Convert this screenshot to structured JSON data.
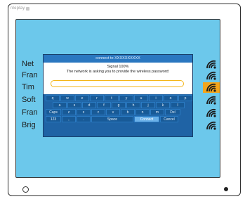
{
  "brand": {
    "label": "nleplay"
  },
  "networks": [
    {
      "name": "Net",
      "selected": false
    },
    {
      "name": "Fran",
      "selected": false
    },
    {
      "name": "Tim",
      "selected": true
    },
    {
      "name": "Soft",
      "selected": false
    },
    {
      "name": "Fran",
      "selected": false
    },
    {
      "name": "Brig",
      "selected": false
    }
  ],
  "dialog": {
    "title": "connect to XXXXXXXXXX",
    "signal": "Signal 100%",
    "prompt": "The network is asking you to provide the wireless password:",
    "password_value": "",
    "password_placeholder": ""
  },
  "keyboard": {
    "row1": [
      "q",
      "w",
      "e",
      "r",
      "t",
      "y",
      "u",
      "i",
      "o",
      "p"
    ],
    "row2": [
      "a",
      "s",
      "d",
      "f",
      "g",
      "h",
      "j",
      "k",
      "l"
    ],
    "row3": [
      "Caps",
      "z",
      "x",
      "c",
      "v",
      "b",
      "n",
      "m",
      "Del"
    ],
    "row4": [
      "123",
      ",",
      ".",
      "Space",
      "Connect",
      "Cancel"
    ]
  },
  "colors": {
    "screen": "#6cc8eb",
    "dialog": "#1f63a5",
    "selected": "#f3a51c",
    "input_border": "#f4b619"
  }
}
